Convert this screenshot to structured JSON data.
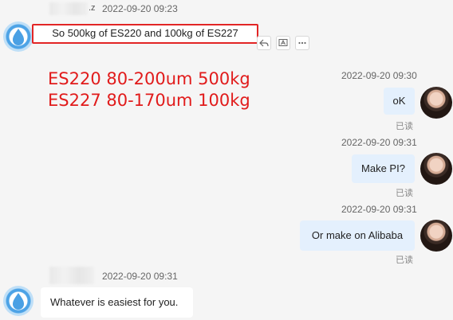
{
  "messages": [
    {
      "sender_suffix": ".z",
      "time": "2022-09-20 09:23",
      "text": "So 500kg of ES220 and 100kg of ES227"
    },
    {
      "time": "2022-09-20 09:30",
      "text": "oK",
      "status": "已读"
    },
    {
      "time": "2022-09-20 09:31",
      "text": "Make PI?",
      "status": "已读"
    },
    {
      "time": "2022-09-20 09:31",
      "text": "Or make on Alibaba",
      "status": "已读"
    },
    {
      "time": "2022-09-20 09:31",
      "text": "Whatever is easiest for you."
    }
  ],
  "annotation": {
    "line1": "ES220 80-200um 500kg",
    "line2": "ES227 80-170um 100kg"
  },
  "colors": {
    "highlight_border": "#e22525",
    "annotation_text": "#e11b1b",
    "outgoing_bubble": "#e4f0fd",
    "incoming_bubble": "#ffffff",
    "background": "#f5f5f5"
  },
  "icons": [
    "reply-icon",
    "translate-icon",
    "more-icon"
  ]
}
